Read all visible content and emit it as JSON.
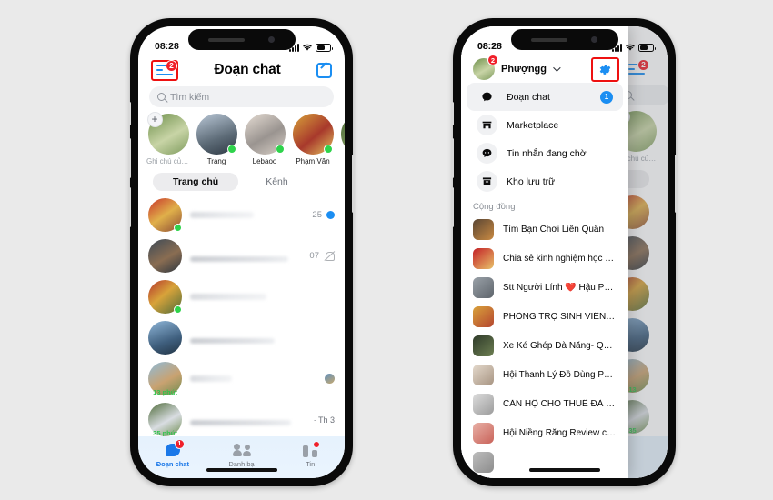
{
  "background_color": "#eaeaea",
  "accent_blue": "#1b8ef2",
  "badge_red": "#f0202a",
  "online_green": "#2ed34b",
  "highlight_box_color": "#ee1111",
  "left_phone": {
    "status_bar": {
      "time": "08:28",
      "signal_icon": "cellular-bars-icon",
      "wifi_icon": "wifi-icon",
      "battery_icon": "battery-icon"
    },
    "header": {
      "menu_icon": "menu-list-icon",
      "menu_badge": "2",
      "title": "Đoạn chat",
      "compose_icon": "compose-pencil-icon"
    },
    "search": {
      "placeholder": "Tìm kiếm",
      "icon": "search-icon"
    },
    "stories": [
      {
        "name": "Ghi chú của b...",
        "muted": true,
        "has_plus": true,
        "online": false
      },
      {
        "name": "Trang",
        "muted": false,
        "has_plus": false,
        "online": true
      },
      {
        "name": "Lebaoo",
        "muted": false,
        "has_plus": false,
        "online": true
      },
      {
        "name": "Phạm Văn",
        "muted": false,
        "has_plus": false,
        "online": true
      },
      {
        "name": "",
        "muted": false,
        "has_plus": false,
        "online": false
      }
    ],
    "tabs": [
      {
        "label": "Trang chủ",
        "active": true
      },
      {
        "label": "Kênh",
        "active": false
      }
    ],
    "chats": [
      {
        "online": true,
        "meta_number": "25",
        "unread": true,
        "muted": false,
        "status_time": ""
      },
      {
        "online": false,
        "meta_number": "07",
        "unread": false,
        "muted": true,
        "status_time": ""
      },
      {
        "online": true,
        "meta_number": "",
        "unread": false,
        "muted": false,
        "status_time": ""
      },
      {
        "online": false,
        "meta_number": "",
        "unread": false,
        "muted": false,
        "status_time": ""
      },
      {
        "online": false,
        "meta_number": "",
        "unread": false,
        "muted": false,
        "status_time": "13 phút",
        "seen_avatar": true
      },
      {
        "online": false,
        "meta_number": "",
        "unread": false,
        "muted": false,
        "status_time": "35 phút",
        "date": "· Th 3"
      }
    ],
    "bottom_nav": [
      {
        "label": "Đoạn chat",
        "icon": "chat-bubble-icon",
        "active": true,
        "badge": "1"
      },
      {
        "label": "Danh bạ",
        "icon": "contacts-people-icon",
        "active": false,
        "badge": ""
      },
      {
        "label": "Tin",
        "icon": "stories-bars-icon",
        "active": false,
        "badge": "dot"
      }
    ]
  },
  "right_phone": {
    "status_bar": {
      "time": "08:28",
      "signal_icon": "cellular-bars-icon",
      "wifi_icon": "wifi-icon",
      "battery_icon": "battery-icon"
    },
    "drawer": {
      "user_name": "Phượngg",
      "user_badge": "2",
      "avatar_icon": "user-avatar",
      "chevron_icon": "chevron-down-icon",
      "settings_icon": "gear-icon",
      "items": [
        {
          "label": "Đoạn chat",
          "icon": "chat-bubble-icon",
          "selected": true,
          "badge": "1"
        },
        {
          "label": "Marketplace",
          "icon": "marketplace-store-icon",
          "selected": false,
          "badge": ""
        },
        {
          "label": "Tin nhắn đang chờ",
          "icon": "pending-message-icon",
          "selected": false,
          "badge": ""
        },
        {
          "label": "Kho lưu trữ",
          "icon": "archive-box-icon",
          "selected": false,
          "badge": ""
        }
      ],
      "section_label": "Cộng đồng",
      "groups": [
        {
          "label": "Tìm Bạn Chơi Liên Quân",
          "color1": "#5a4634",
          "color2": "#c98a42"
        },
        {
          "label": "Chia sẻ kinh nghiệm học Tiếng...",
          "color1": "#c32026",
          "color2": "#e8c26a"
        },
        {
          "label": "Stt Người Lính ❤️ Hậu Phương",
          "color1": "#9aa1a8",
          "color2": "#5d646b"
        },
        {
          "label": "PHÒNG TRỌ SINH VIÊN ĐÀ NẴ...",
          "color1": "#d9a23b",
          "color2": "#b4452f"
        },
        {
          "label": "Xe Ké Ghép Đà Nẵng- Quảng n...",
          "color1": "#2f3b2a",
          "color2": "#6d7f52"
        },
        {
          "label": "Hội Thanh Lý Đồ Dùng Phòng T...",
          "color1": "#e4d9cc",
          "color2": "#a79482"
        },
        {
          "label": "CĂN HỘ CHO THUÊ ĐÀ NẴNG",
          "color1": "#dcdcdc",
          "color2": "#9c9c9c"
        },
        {
          "label": "Hội Niềng Răng Review có tâm",
          "color1": "#e8b0a6",
          "color2": "#c9635a"
        },
        {
          "label": "",
          "color1": "#bdbdbd",
          "color2": "#8c8c8c"
        }
      ]
    },
    "underlying": {
      "menu_icon": "menu-list-icon",
      "menu_badge": "2",
      "search_icon": "search-icon",
      "story_plus_icon": "plus-icon",
      "story_label": "Ghi chú của b...",
      "chat_status_times": [
        "13",
        "35"
      ]
    }
  }
}
